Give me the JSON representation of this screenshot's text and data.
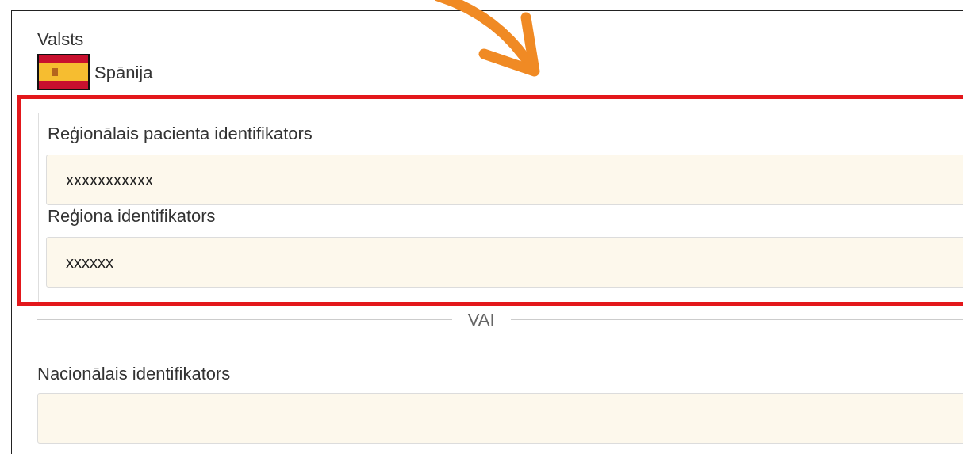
{
  "country": {
    "label": "Valsts",
    "value": "Spānija"
  },
  "regional_fields": [
    {
      "label": "Reģionālais pacienta identifikators",
      "value": "xxxxxxxxxxx"
    },
    {
      "label": "Reģiona identifikators",
      "value": "xxxxxx"
    }
  ],
  "divider": "VAI",
  "national_field": {
    "label": "Nacionālais identifikators"
  }
}
